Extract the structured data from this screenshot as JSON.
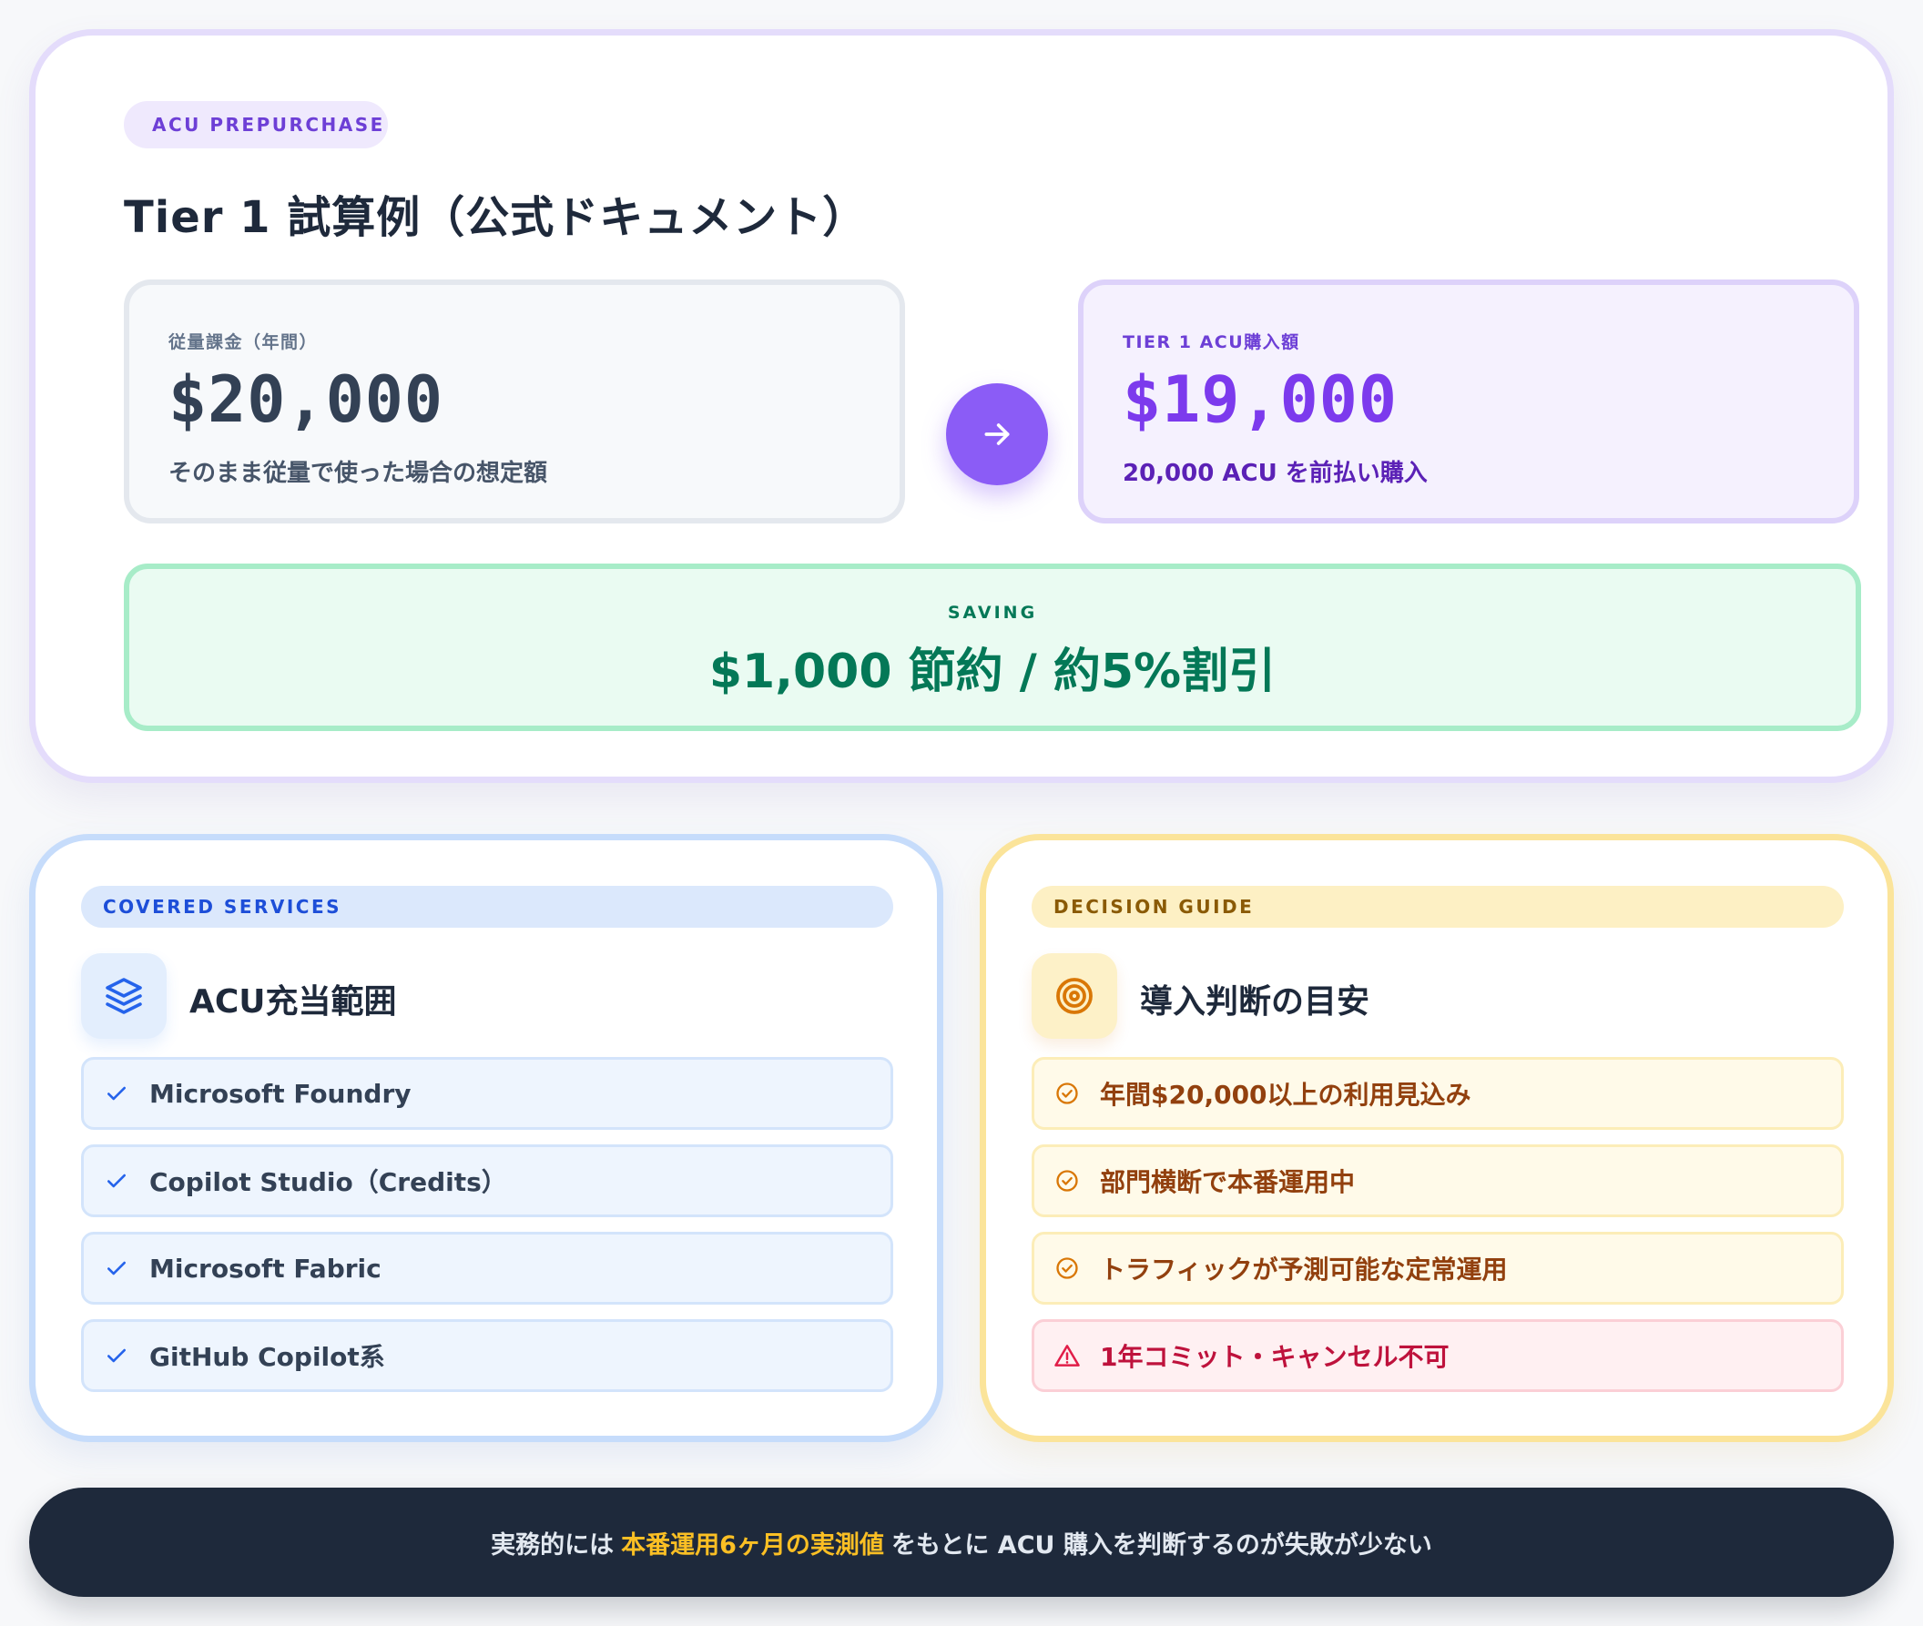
{
  "tier": {
    "badge": "ACU PREPURCHASE",
    "title": "Tier 1 試算例（公式ドキュメント）",
    "payg": {
      "label": "従量課金（年間）",
      "value": "$20,000",
      "desc": "そのまま従量で使った場合の想定額"
    },
    "prepurchase": {
      "label": "TIER 1 ACU購入額",
      "value": "$19,000",
      "desc": "20,000 ACU を前払い購入"
    },
    "saving": {
      "label": "SAVING",
      "value": "$1,000 節約 / 約5%割引"
    }
  },
  "covered": {
    "badge": "COVERED SERVICES",
    "title": "ACU充当範囲",
    "icon": "layers-icon",
    "items": [
      "Microsoft Foundry",
      "Copilot Studio（Credits）",
      "Microsoft Fabric",
      "GitHub Copilot系"
    ]
  },
  "decision": {
    "badge": "DECISION GUIDE",
    "title": "導入判断の目安",
    "icon": "target-icon",
    "items": [
      "年間$20,000以上の利用見込み",
      "部門横断で本番運用中",
      "トラフィックが予測可能な定常運用",
      "1年コミット・キャンセル不可"
    ]
  },
  "footer": {
    "before": "実務的には",
    "highlight": "本番運用6ヶ月の実測値",
    "after": "をもとに ACU 購入を判断するのが失敗が少ない"
  },
  "colors": {
    "accent_purple": "#8b5cf6",
    "saving_green": "#047857",
    "blue": "#1d4ed8",
    "amber": "#92400e",
    "warning_red": "#be123c",
    "footer_bg": "#1e293b",
    "footer_highlight": "#fbbf24"
  }
}
